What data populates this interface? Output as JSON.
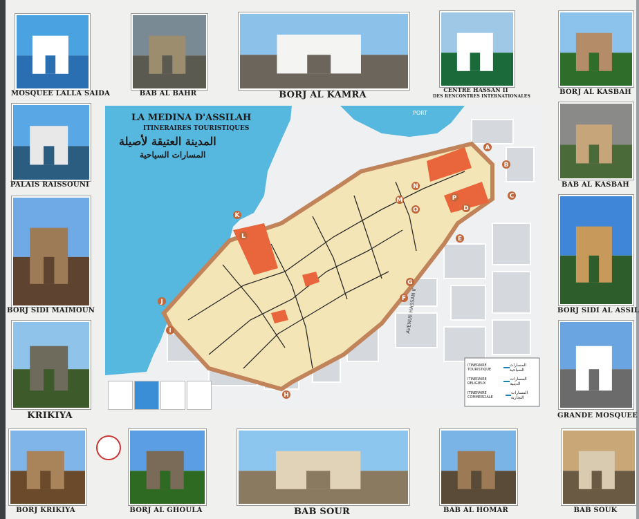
{
  "photos": [
    {
      "id": "mosquee-lalla-saida",
      "caption": "MOSQUEE LALLA SAIDA"
    },
    {
      "id": "bab-al-bahr",
      "caption": "BAB AL BAHR"
    },
    {
      "id": "borj-al-kamra",
      "caption": "BORJ AL KAMRA"
    },
    {
      "id": "centre-hassan-ii",
      "caption": "CENTRE HASSAN II",
      "caption2": "DES RENCONTRES INTERNATIONALES"
    },
    {
      "id": "borj-al-kasbah",
      "caption": "BORJ AL KASBAH"
    },
    {
      "id": "palais-raissouni",
      "caption": "PALAIS RAISSOUNI"
    },
    {
      "id": "bab-al-kasbah",
      "caption": "BAB AL KASBAH"
    },
    {
      "id": "borj-sidi-maimoun",
      "caption": "BORJ SIDI MAIMOUN"
    },
    {
      "id": "borj-sidi-al-assili",
      "caption": "BORJ SIDI AL ASSILI"
    },
    {
      "id": "krikiya",
      "caption": "KRIKIYA"
    },
    {
      "id": "grande-mosquee",
      "caption": "GRANDE MOSQUEE"
    },
    {
      "id": "borj-krikiya",
      "caption": "BORJ KRIKIYA"
    },
    {
      "id": "borj-al-ghoula",
      "caption": "BORJ AL GHOULA"
    },
    {
      "id": "bab-sour",
      "caption": "BAB SOUR"
    },
    {
      "id": "bab-al-homar",
      "caption": "BAB AL HOMAR"
    },
    {
      "id": "bab-souk",
      "caption": "BAB SOUK"
    }
  ],
  "map": {
    "title": "LA MEDINA D'ASSILAH",
    "subtitle": "ITINERAIRES TOURISTIQUES",
    "title_ar": "المدينة العتيقة لأصيلة",
    "subtitle_ar": "المسارات السياحية",
    "port_label": "PORT",
    "street_label": "AVENUE HASSAN II",
    "markers": [
      "A",
      "B",
      "C",
      "D",
      "E",
      "F",
      "G",
      "H",
      "I",
      "J",
      "K",
      "L",
      "M",
      "N",
      "O",
      "P"
    ],
    "legend": [
      {
        "fr": "ITINERAIRE TOURISTIQUE",
        "ar": "المسارات السياحية",
        "color": "#1a7fb5"
      },
      {
        "fr": "ITINERAIRE RELIGIEUX",
        "ar": "المسارات الدينية",
        "color": "#1a7fb5"
      },
      {
        "fr": "ITINERAIRE COMMERCIALE",
        "ar": "المسارات التجارية",
        "color": "#1a7fb5"
      }
    ]
  }
}
